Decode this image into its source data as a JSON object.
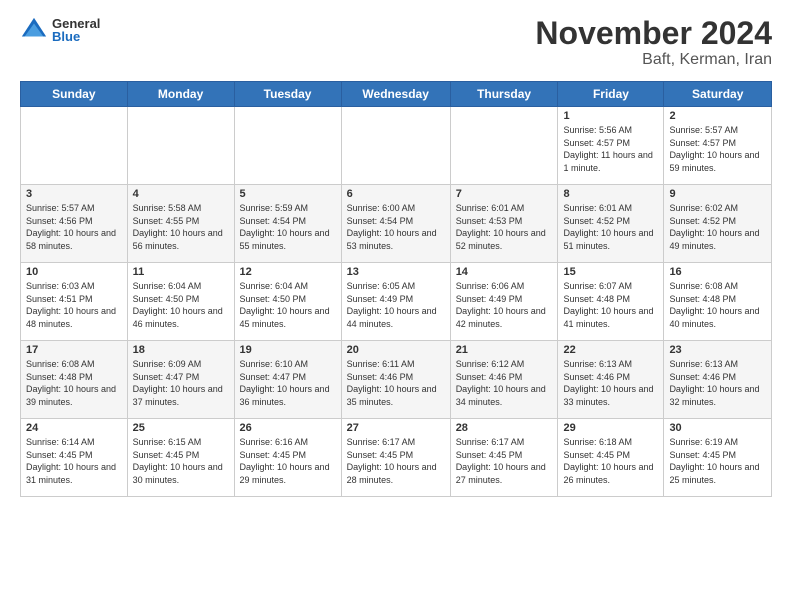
{
  "logo": {
    "general": "General",
    "blue": "Blue"
  },
  "header": {
    "title": "November 2024",
    "subtitle": "Baft, Kerman, Iran"
  },
  "days_of_week": [
    "Sunday",
    "Monday",
    "Tuesday",
    "Wednesday",
    "Thursday",
    "Friday",
    "Saturday"
  ],
  "weeks": [
    [
      {
        "day": "",
        "info": ""
      },
      {
        "day": "",
        "info": ""
      },
      {
        "day": "",
        "info": ""
      },
      {
        "day": "",
        "info": ""
      },
      {
        "day": "",
        "info": ""
      },
      {
        "day": "1",
        "info": "Sunrise: 5:56 AM\nSunset: 4:57 PM\nDaylight: 11 hours\nand 1 minute."
      },
      {
        "day": "2",
        "info": "Sunrise: 5:57 AM\nSunset: 4:57 PM\nDaylight: 10 hours\nand 59 minutes."
      }
    ],
    [
      {
        "day": "3",
        "info": "Sunrise: 5:57 AM\nSunset: 4:56 PM\nDaylight: 10 hours\nand 58 minutes."
      },
      {
        "day": "4",
        "info": "Sunrise: 5:58 AM\nSunset: 4:55 PM\nDaylight: 10 hours\nand 56 minutes."
      },
      {
        "day": "5",
        "info": "Sunrise: 5:59 AM\nSunset: 4:54 PM\nDaylight: 10 hours\nand 55 minutes."
      },
      {
        "day": "6",
        "info": "Sunrise: 6:00 AM\nSunset: 4:54 PM\nDaylight: 10 hours\nand 53 minutes."
      },
      {
        "day": "7",
        "info": "Sunrise: 6:01 AM\nSunset: 4:53 PM\nDaylight: 10 hours\nand 52 minutes."
      },
      {
        "day": "8",
        "info": "Sunrise: 6:01 AM\nSunset: 4:52 PM\nDaylight: 10 hours\nand 51 minutes."
      },
      {
        "day": "9",
        "info": "Sunrise: 6:02 AM\nSunset: 4:52 PM\nDaylight: 10 hours\nand 49 minutes."
      }
    ],
    [
      {
        "day": "10",
        "info": "Sunrise: 6:03 AM\nSunset: 4:51 PM\nDaylight: 10 hours\nand 48 minutes."
      },
      {
        "day": "11",
        "info": "Sunrise: 6:04 AM\nSunset: 4:50 PM\nDaylight: 10 hours\nand 46 minutes."
      },
      {
        "day": "12",
        "info": "Sunrise: 6:04 AM\nSunset: 4:50 PM\nDaylight: 10 hours\nand 45 minutes."
      },
      {
        "day": "13",
        "info": "Sunrise: 6:05 AM\nSunset: 4:49 PM\nDaylight: 10 hours\nand 44 minutes."
      },
      {
        "day": "14",
        "info": "Sunrise: 6:06 AM\nSunset: 4:49 PM\nDaylight: 10 hours\nand 42 minutes."
      },
      {
        "day": "15",
        "info": "Sunrise: 6:07 AM\nSunset: 4:48 PM\nDaylight: 10 hours\nand 41 minutes."
      },
      {
        "day": "16",
        "info": "Sunrise: 6:08 AM\nSunset: 4:48 PM\nDaylight: 10 hours\nand 40 minutes."
      }
    ],
    [
      {
        "day": "17",
        "info": "Sunrise: 6:08 AM\nSunset: 4:48 PM\nDaylight: 10 hours\nand 39 minutes."
      },
      {
        "day": "18",
        "info": "Sunrise: 6:09 AM\nSunset: 4:47 PM\nDaylight: 10 hours\nand 37 minutes."
      },
      {
        "day": "19",
        "info": "Sunrise: 6:10 AM\nSunset: 4:47 PM\nDaylight: 10 hours\nand 36 minutes."
      },
      {
        "day": "20",
        "info": "Sunrise: 6:11 AM\nSunset: 4:46 PM\nDaylight: 10 hours\nand 35 minutes."
      },
      {
        "day": "21",
        "info": "Sunrise: 6:12 AM\nSunset: 4:46 PM\nDaylight: 10 hours\nand 34 minutes."
      },
      {
        "day": "22",
        "info": "Sunrise: 6:13 AM\nSunset: 4:46 PM\nDaylight: 10 hours\nand 33 minutes."
      },
      {
        "day": "23",
        "info": "Sunrise: 6:13 AM\nSunset: 4:46 PM\nDaylight: 10 hours\nand 32 minutes."
      }
    ],
    [
      {
        "day": "24",
        "info": "Sunrise: 6:14 AM\nSunset: 4:45 PM\nDaylight: 10 hours\nand 31 minutes."
      },
      {
        "day": "25",
        "info": "Sunrise: 6:15 AM\nSunset: 4:45 PM\nDaylight: 10 hours\nand 30 minutes."
      },
      {
        "day": "26",
        "info": "Sunrise: 6:16 AM\nSunset: 4:45 PM\nDaylight: 10 hours\nand 29 minutes."
      },
      {
        "day": "27",
        "info": "Sunrise: 6:17 AM\nSunset: 4:45 PM\nDaylight: 10 hours\nand 28 minutes."
      },
      {
        "day": "28",
        "info": "Sunrise: 6:17 AM\nSunset: 4:45 PM\nDaylight: 10 hours\nand 27 minutes."
      },
      {
        "day": "29",
        "info": "Sunrise: 6:18 AM\nSunset: 4:45 PM\nDaylight: 10 hours\nand 26 minutes."
      },
      {
        "day": "30",
        "info": "Sunrise: 6:19 AM\nSunset: 4:45 PM\nDaylight: 10 hours\nand 25 minutes."
      }
    ]
  ]
}
